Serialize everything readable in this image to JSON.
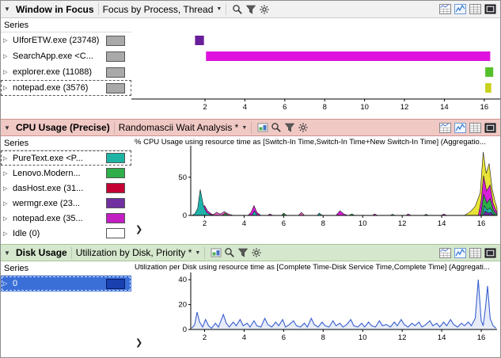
{
  "ui": {
    "collapse_glyph": "▼",
    "dropdown_glyph": "▼",
    "row_expand_glyph": "▷",
    "expander_glyph": "❯"
  },
  "theme": {
    "p1_hdr": "#f2f1f2",
    "p1_border": "#c9c9c9",
    "p2_hdr": "#f0c9c5",
    "p2_border": "#cf938d",
    "p3_hdr": "#d5e7cc",
    "p3_border": "#a6c497",
    "sel": "#3a6fd8",
    "axis": "#000000"
  },
  "panels": {
    "panel1": {
      "title": "Window in Focus",
      "preset": "Focus by Process, Thread",
      "series_header": "Series",
      "toolbar_left": [
        "search",
        "filter",
        "settings"
      ],
      "toolbar_right": [
        "graph-table",
        "graph",
        "table",
        "fullscreen"
      ],
      "series": [
        {
          "label": "UIforETW.exe (23748)",
          "color": "#a9a9a9"
        },
        {
          "label": "SearchApp.exe <C...",
          "color": "#a9a9a9"
        },
        {
          "label": "explorer.exe (11088)",
          "color": "#a9a9a9"
        },
        {
          "label": "notepad.exe (3576)",
          "color": "#a9a9a9",
          "focused": true
        }
      ],
      "chart_data": {
        "type": "timeline",
        "x_range": [
          -1.69,
          16.8
        ],
        "x_ticks": [
          2,
          4,
          6,
          8,
          10,
          12,
          14,
          16
        ],
        "bars": [
          {
            "series": "UIforETW.exe",
            "row": 0,
            "start": 1.5,
            "end": 1.95,
            "color": "#6a1f9a"
          },
          {
            "series": "SearchApp.exe",
            "row": 1,
            "start": 2.05,
            "end": 16.3,
            "color": "#df13df"
          },
          {
            "series": "explorer.exe",
            "row": 2,
            "start": 16.05,
            "end": 16.45,
            "color": "#56c02b"
          },
          {
            "series": "notepad.exe",
            "row": 3,
            "start": 16.05,
            "end": 16.35,
            "color": "#c9d11c"
          }
        ]
      }
    },
    "panel2": {
      "title": "CPU Usage (Precise)",
      "preset": "Randomascii Wait Analysis *",
      "series_header": "Series",
      "toolbar_left": [
        "view-editor",
        "search",
        "filter",
        "settings"
      ],
      "toolbar_right": [
        "graph-table",
        "graph",
        "table",
        "fullscreen"
      ],
      "chart_title": "% CPU Usage using resource time as [Switch-In Time,Switch-In Time+New Switch-In Time] (Aggregatio...",
      "series": [
        {
          "label": "PureText.exe <P...",
          "color": "#1fb3a4",
          "focused": true
        },
        {
          "label": "Lenovo.Modern...",
          "color": "#2fae4a"
        },
        {
          "label": "dasHost.exe (31...",
          "color": "#c40233"
        },
        {
          "label": "wermgr.exe (23...",
          "color": "#7030a0"
        },
        {
          "label": "notepad.exe (35...",
          "color": "#c21ec2"
        },
        {
          "label": "Idle (0)",
          "color": "#ffffff"
        }
      ],
      "chart_data": {
        "type": "area",
        "x_range": [
          1.3,
          16.8
        ],
        "x_ticks": [
          2,
          4,
          6,
          8,
          10,
          12,
          14,
          16
        ],
        "y_ticks": [
          0,
          50
        ],
        "y_max": 85,
        "areas": [
          {
            "color": "#d81ed8",
            "points": [
              [
                1.75,
                0
              ],
              [
                1.9,
                9
              ],
              [
                2.0,
                13
              ],
              [
                2.15,
                6
              ],
              [
                2.35,
                2
              ],
              [
                2.6,
                0
              ]
            ]
          },
          {
            "color": "#20b2aa",
            "points": [
              [
                1.35,
                0
              ],
              [
                1.5,
                2
              ],
              [
                1.65,
                9
              ],
              [
                1.78,
                34
              ],
              [
                1.95,
                12
              ],
              [
                2.1,
                4
              ],
              [
                2.3,
                1
              ],
              [
                2.5,
                0
              ]
            ]
          },
          {
            "color": "#e060c0",
            "points": [
              [
                2.4,
                0
              ],
              [
                2.6,
                4
              ],
              [
                2.8,
                2
              ],
              [
                3.0,
                5
              ],
              [
                3.2,
                2
              ],
              [
                3.45,
                0
              ]
            ]
          },
          {
            "color": "#2fae4a",
            "points": [
              [
                2.9,
                0
              ],
              [
                3.05,
                3
              ],
              [
                3.2,
                0
              ]
            ]
          },
          {
            "color": "#d81ed8",
            "points": [
              [
                4.2,
                0
              ],
              [
                4.35,
                4
              ],
              [
                4.5,
                13
              ],
              [
                4.65,
                4
              ],
              [
                4.85,
                0
              ]
            ]
          },
          {
            "color": "#20b2aa",
            "points": [
              [
                4.4,
                0
              ],
              [
                4.52,
                6
              ],
              [
                4.68,
                0
              ]
            ]
          },
          {
            "color": "#d81ed8",
            "points": [
              [
                5.2,
                0
              ],
              [
                5.3,
                2
              ],
              [
                5.45,
                0
              ]
            ]
          },
          {
            "color": "#2fae4a",
            "points": [
              [
                5.9,
                0
              ],
              [
                6.0,
                3
              ],
              [
                6.15,
                0
              ]
            ]
          },
          {
            "color": "#e060c0",
            "points": [
              [
                6.75,
                0
              ],
              [
                6.9,
                4
              ],
              [
                7.05,
                0
              ]
            ]
          },
          {
            "color": "#20b2aa",
            "points": [
              [
                7.7,
                0
              ],
              [
                7.8,
                3
              ],
              [
                7.95,
                0
              ]
            ]
          },
          {
            "color": "#d81ed8",
            "points": [
              [
                8.65,
                0
              ],
              [
                8.85,
                6
              ],
              [
                9.05,
                2
              ],
              [
                9.25,
                0
              ]
            ]
          },
          {
            "color": "#2fae4a",
            "points": [
              [
                9.3,
                0
              ],
              [
                9.45,
                2
              ],
              [
                9.6,
                0
              ]
            ]
          },
          {
            "color": "#d81ed8",
            "points": [
              [
                10.5,
                0
              ],
              [
                10.6,
                2
              ],
              [
                10.75,
                0
              ]
            ]
          },
          {
            "color": "#20b2aa",
            "points": [
              [
                11.4,
                0
              ],
              [
                11.5,
                1.5
              ],
              [
                11.65,
                0
              ]
            ]
          },
          {
            "color": "#d81ed8",
            "points": [
              [
                12.2,
                0
              ],
              [
                12.3,
                2
              ],
              [
                12.45,
                0
              ]
            ]
          },
          {
            "color": "#2fae4a",
            "points": [
              [
                13.1,
                0
              ],
              [
                13.2,
                1.5
              ],
              [
                13.35,
                0
              ]
            ]
          },
          {
            "color": "#d81ed8",
            "points": [
              [
                14.0,
                0
              ],
              [
                14.1,
                2
              ],
              [
                14.25,
                0
              ]
            ]
          },
          {
            "color": "#e8e337",
            "points": [
              [
                15.15,
                0
              ],
              [
                15.45,
                5
              ],
              [
                15.7,
                12
              ],
              [
                15.95,
                30
              ],
              [
                16.1,
                83
              ],
              [
                16.25,
                55
              ],
              [
                16.4,
                68
              ],
              [
                16.55,
                35
              ],
              [
                16.7,
                18
              ],
              [
                16.8,
                10
              ]
            ]
          },
          {
            "color": "#d81ed8",
            "points": [
              [
                15.85,
                0
              ],
              [
                16.0,
                20
              ],
              [
                16.12,
                52
              ],
              [
                16.27,
                32
              ],
              [
                16.45,
                40
              ],
              [
                16.6,
                16
              ],
              [
                16.75,
                6
              ],
              [
                16.8,
                4
              ]
            ]
          },
          {
            "color": "#2fae4a",
            "points": [
              [
                15.98,
                0
              ],
              [
                16.12,
                28
              ],
              [
                16.28,
                16
              ],
              [
                16.45,
                22
              ],
              [
                16.6,
                8
              ],
              [
                16.72,
                3
              ],
              [
                16.8,
                1
              ]
            ]
          },
          {
            "color": "#20b2aa",
            "points": [
              [
                16.05,
                0
              ],
              [
                16.15,
                13
              ],
              [
                16.3,
                7
              ],
              [
                16.45,
                10
              ],
              [
                16.6,
                4
              ],
              [
                16.7,
                0
              ]
            ]
          },
          {
            "color": "#7030a0",
            "points": [
              [
                16.1,
                0
              ],
              [
                16.2,
                6
              ],
              [
                16.35,
                3
              ],
              [
                16.5,
                4
              ],
              [
                16.6,
                1
              ],
              [
                16.65,
                0
              ]
            ]
          }
        ]
      }
    },
    "panel3": {
      "title": "Disk Usage",
      "preset": "Utilization by Disk, Priority *",
      "series_header": "Series",
      "toolbar_left": [
        "view-editor",
        "search",
        "filter",
        "settings"
      ],
      "toolbar_right": [
        "graph-table",
        "graph",
        "table",
        "fullscreen"
      ],
      "chart_title": "Utilization per Disk using resource time as [Complete Time-Disk Service Time,Complete Time] (Aggregati...",
      "series": [
        {
          "label": "0",
          "color": "#1a3fae",
          "selected": true
        }
      ],
      "chart_data": {
        "type": "line",
        "color": "#3a5fd0",
        "fill": "rgba(58,95,208,0.12)",
        "x_range": [
          1.3,
          16.8
        ],
        "x_ticks": [
          2,
          4,
          6,
          8,
          10,
          12,
          14,
          16
        ],
        "y_ticks": [
          0,
          20,
          40
        ],
        "y_max": 42,
        "points": [
          [
            1.35,
            1
          ],
          [
            1.5,
            4
          ],
          [
            1.62,
            14
          ],
          [
            1.75,
            6
          ],
          [
            1.9,
            2
          ],
          [
            2.05,
            8
          ],
          [
            2.2,
            3
          ],
          [
            2.35,
            1
          ],
          [
            2.55,
            5
          ],
          [
            2.7,
            2
          ],
          [
            2.95,
            12
          ],
          [
            3.1,
            5
          ],
          [
            3.25,
            2
          ],
          [
            3.45,
            6
          ],
          [
            3.6,
            3
          ],
          [
            3.8,
            8
          ],
          [
            3.95,
            3
          ],
          [
            4.15,
            5
          ],
          [
            4.3,
            2
          ],
          [
            4.5,
            7
          ],
          [
            4.65,
            3
          ],
          [
            4.85,
            2
          ],
          [
            5.05,
            9
          ],
          [
            5.2,
            4
          ],
          [
            5.4,
            2
          ],
          [
            5.6,
            6
          ],
          [
            5.75,
            3
          ],
          [
            5.95,
            8
          ],
          [
            6.1,
            2
          ],
          [
            6.3,
            4
          ],
          [
            6.5,
            7
          ],
          [
            6.65,
            3
          ],
          [
            6.85,
            2
          ],
          [
            7.05,
            5
          ],
          [
            7.2,
            2
          ],
          [
            7.4,
            9
          ],
          [
            7.55,
            4
          ],
          [
            7.75,
            2
          ],
          [
            7.95,
            6
          ],
          [
            8.1,
            3
          ],
          [
            8.3,
            2
          ],
          [
            8.5,
            7
          ],
          [
            8.65,
            3
          ],
          [
            8.85,
            5
          ],
          [
            9.0,
            2
          ],
          [
            9.2,
            4
          ],
          [
            9.4,
            8
          ],
          [
            9.55,
            3
          ],
          [
            9.75,
            2
          ],
          [
            9.95,
            5
          ],
          [
            10.1,
            2
          ],
          [
            10.3,
            6
          ],
          [
            10.45,
            3
          ],
          [
            10.65,
            2
          ],
          [
            10.85,
            7
          ],
          [
            11.0,
            3
          ],
          [
            11.2,
            4
          ],
          [
            11.4,
            2
          ],
          [
            11.6,
            6
          ],
          [
            11.75,
            3
          ],
          [
            11.95,
            8
          ],
          [
            12.1,
            4
          ],
          [
            12.3,
            2
          ],
          [
            12.5,
            5
          ],
          [
            12.65,
            3
          ],
          [
            12.85,
            6
          ],
          [
            13.0,
            2
          ],
          [
            13.2,
            4
          ],
          [
            13.4,
            7
          ],
          [
            13.55,
            3
          ],
          [
            13.75,
            5
          ],
          [
            13.9,
            2
          ],
          [
            14.1,
            6
          ],
          [
            14.25,
            3
          ],
          [
            14.45,
            8
          ],
          [
            14.6,
            4
          ],
          [
            14.8,
            2
          ],
          [
            15.0,
            5
          ],
          [
            15.15,
            3
          ],
          [
            15.35,
            6
          ],
          [
            15.5,
            3
          ],
          [
            15.7,
            9
          ],
          [
            15.85,
            40
          ],
          [
            16.0,
            7
          ],
          [
            16.1,
            3
          ],
          [
            16.22,
            18
          ],
          [
            16.32,
            35
          ],
          [
            16.45,
            9
          ],
          [
            16.6,
            3
          ],
          [
            16.75,
            1
          ]
        ]
      }
    }
  }
}
